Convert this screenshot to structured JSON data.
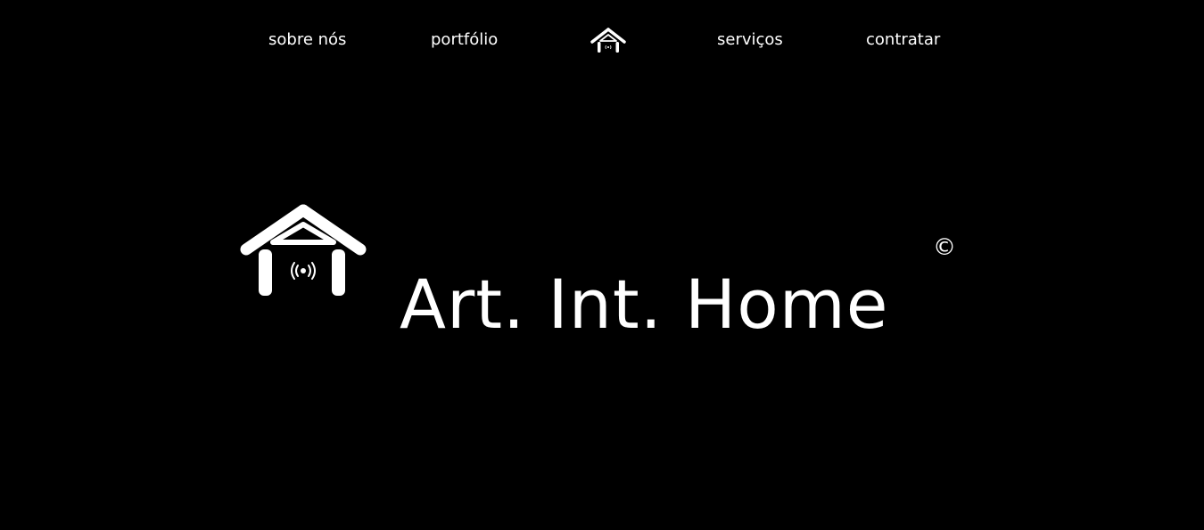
{
  "nav": {
    "items": [
      {
        "label": "sobre nós"
      },
      {
        "label": "portfólio"
      },
      {
        "label": "serviços"
      },
      {
        "label": "contratar"
      }
    ],
    "home_icon": "house-logo-icon"
  },
  "hero": {
    "title": "Art. Int. Home",
    "copyright": "©",
    "logo_icon": "house-wifi-logo-icon"
  },
  "colors": {
    "background": "#000000",
    "foreground": "#ffffff"
  }
}
